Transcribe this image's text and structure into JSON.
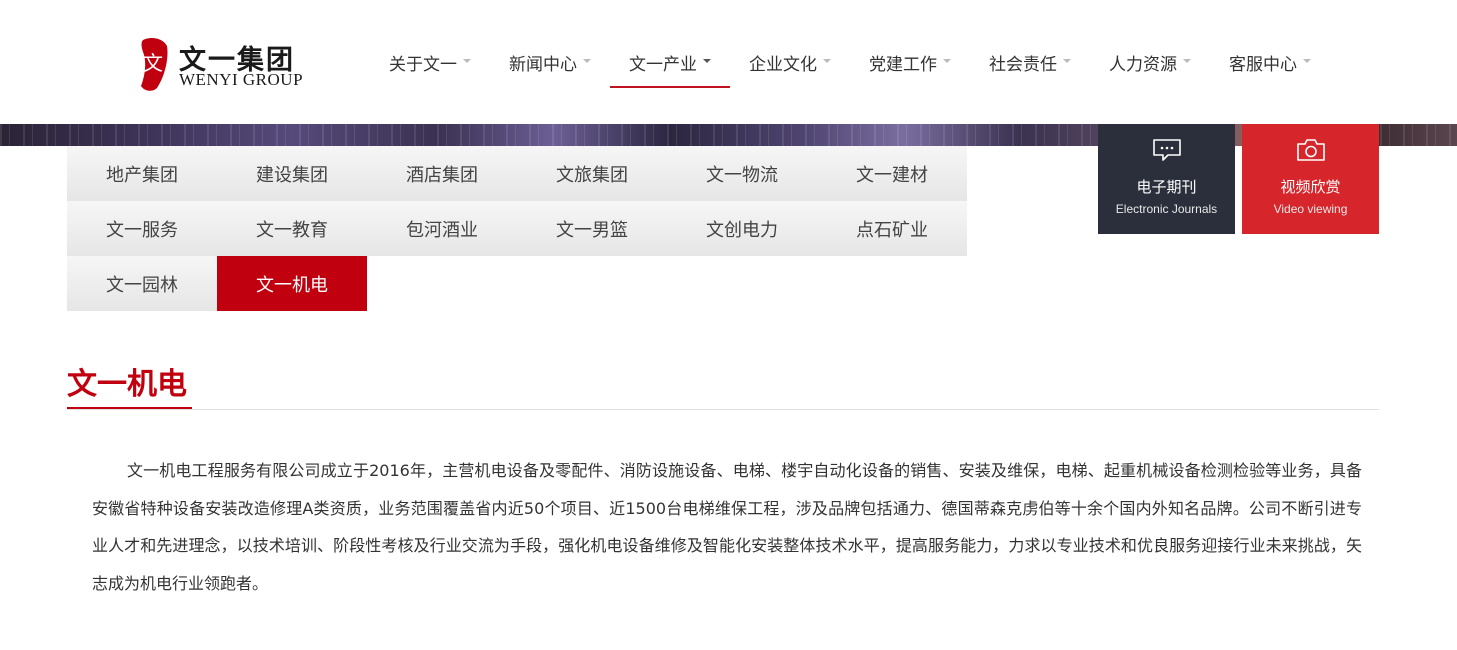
{
  "logo": {
    "mark": "文",
    "cn": "文一集团",
    "en": "WENYI GROUP"
  },
  "nav": {
    "items": [
      {
        "label": "关于文一",
        "active": false
      },
      {
        "label": "新闻中心",
        "active": false
      },
      {
        "label": "文一产业",
        "active": true
      },
      {
        "label": "企业文化",
        "active": false
      },
      {
        "label": "党建工作",
        "active": false
      },
      {
        "label": "社会责任",
        "active": false
      },
      {
        "label": "人力资源",
        "active": false
      },
      {
        "label": "客服中心",
        "active": false
      }
    ]
  },
  "industries": {
    "rows": [
      [
        "地产集团",
        "建设集团",
        "酒店集团",
        "文旅集团",
        "文一物流",
        "文一建材"
      ],
      [
        "文一服务",
        "文一教育",
        "包河酒业",
        "文一男篮",
        "文创电力",
        "点石矿业"
      ],
      [
        "文一园林",
        "文一机电"
      ]
    ],
    "active": "文一机电"
  },
  "side": {
    "journal": {
      "cn": "电子期刊",
      "en": "Electronic Journals",
      "icon": "chat-bubble-icon",
      "color": "#2a2f3b"
    },
    "video": {
      "cn": "视频欣赏",
      "en": "Video viewing",
      "icon": "camera-icon",
      "color": "#d6262c"
    }
  },
  "section": {
    "title": "文一机电",
    "body": "文一机电工程服务有限公司成立于2016年，主营机电设备及零配件、消防设施设备、电梯、楼宇自动化设备的销售、安装及维保，电梯、起重机械设备检测检验等业务，具备安徽省特种设备安装改造修理A类资质，业务范围覆盖省内近50个项目、近1500台电梯维保工程，涉及品牌包括通力、德国蒂森克虏伯等十余个国内外知名品牌。公司不断引进专业人才和先进理念，以技术培训、阶段性考核及行业交流为手段，强化机电设备维修及智能化安装整体技术水平，提高服务能力，力求以专业技术和优良服务迎接行业未来挑战，矢志成为机电行业领跑者。"
  },
  "colors": {
    "accent": "#c1000f"
  }
}
